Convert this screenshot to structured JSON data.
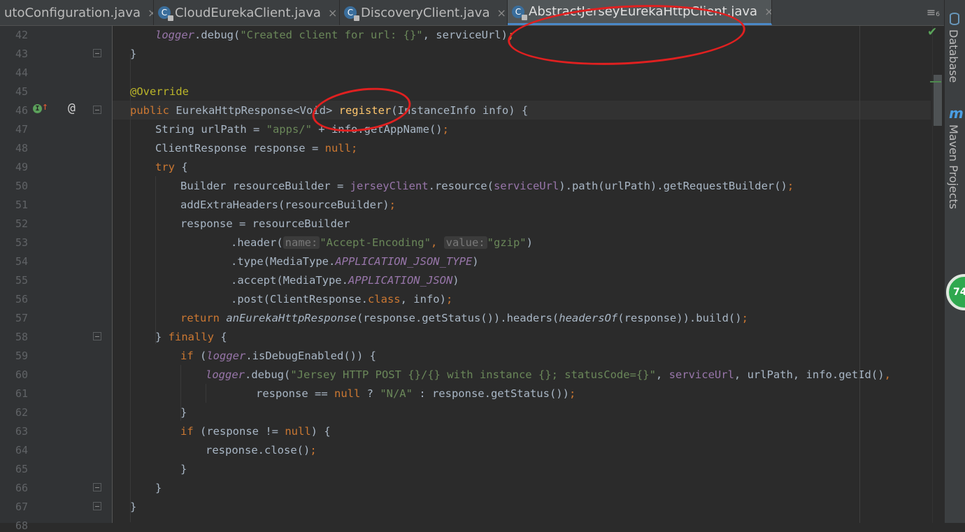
{
  "tabs": [
    {
      "label": "utoConfiguration.java",
      "close": "×",
      "icon": "",
      "active": false
    },
    {
      "label": "CloudEurekaClient.java",
      "close": "×",
      "icon": "C",
      "active": false
    },
    {
      "label": "DiscoveryClient.java",
      "close": "×",
      "icon": "C",
      "active": false
    },
    {
      "label": "AbstractJerseyEurekaHttpClient.java",
      "close": "×",
      "icon": "C",
      "active": true
    }
  ],
  "tab_menu": "≡",
  "tab_menu_count": "6",
  "tool_windows": {
    "database": "Database",
    "maven": "Maven Projects",
    "maven_icon": "m"
  },
  "status_badge": "74",
  "inspection_ok": "✔",
  "gutter": {
    "line_numbers": [
      "42",
      "43",
      "44",
      "45",
      "46",
      "47",
      "48",
      "49",
      "50",
      "51",
      "52",
      "53",
      "54",
      "55",
      "56",
      "57",
      "58",
      "59",
      "60",
      "61",
      "62",
      "63",
      "64",
      "65",
      "66",
      "67",
      "68"
    ],
    "implement_marker": "I",
    "override_arrow": "↑",
    "annotation_marker": "@"
  },
  "hints": {
    "name": "name:",
    "value": "value:"
  },
  "code": {
    "l42_a": "logger",
    "l42_b": ".debug(",
    "l42_c": "\"Created client for url: {}\"",
    "l42_d": ", serviceUrl)",
    "l42_e": ";",
    "l43": "}",
    "l45": "@Override",
    "l46_a": "public ",
    "l46_b": "EurekaHttpResponse<Void> ",
    "l46_c": "register",
    "l46_d": "(InstanceInfo info) {",
    "l47_a": "String urlPath = ",
    "l47_b": "\"apps/\"",
    "l47_c": " + info.getAppName()",
    "l47_d": ";",
    "l48_a": "ClientResponse response = ",
    "l48_b": "null",
    "l48_c": ";",
    "l49_a": "try",
    "l49_b": " {",
    "l50_a": "Builder resourceBuilder = ",
    "l50_b": "jerseyClient",
    "l50_c": ".resource(",
    "l50_d": "serviceUrl",
    "l50_e": ").path(urlPath).getRequestBuilder()",
    "l50_f": ";",
    "l51_a": "addExtraHeaders(resourceBuilder)",
    "l51_b": ";",
    "l52": "response = resourceBuilder",
    "l53_a": ".header(",
    "l53_b": "\"Accept-Encoding\"",
    "l53_c": ", ",
    "l53_d": "\"gzip\"",
    "l53_e": ")",
    "l54_a": ".type(MediaType.",
    "l54_b": "APPLICATION_JSON_TYPE",
    "l54_c": ")",
    "l55_a": ".accept(MediaType.",
    "l55_b": "APPLICATION_JSON",
    "l55_c": ")",
    "l56_a": ".post(ClientResponse.",
    "l56_b": "class",
    "l56_c": ", info)",
    "l56_d": ";",
    "l57_a": "return ",
    "l57_b": "anEurekaHttpResponse",
    "l57_c": "(response.getStatus()).headers(",
    "l57_d": "headersOf",
    "l57_e": "(response)).build()",
    "l57_f": ";",
    "l58_a": "} ",
    "l58_b": "finally",
    "l58_c": " {",
    "l59_a": "if ",
    "l59_b": "(",
    "l59_c": "logger",
    "l59_d": ".isDebugEnabled()) {",
    "l60_a": "logger",
    "l60_b": ".debug(",
    "l60_c": "\"Jersey HTTP POST {}/{} with instance {}; statusCode={}\"",
    "l60_d": ", ",
    "l60_e": "serviceUrl",
    "l60_f": ", urlPath, info.getId()",
    "l60_g": ",",
    "l61_a": "response == ",
    "l61_b": "null",
    "l61_c": " ? ",
    "l61_d": "\"N/A\"",
    "l61_e": " : response.getStatus())",
    "l61_f": ";",
    "l62": "}",
    "l63_a": "if ",
    "l63_b": "(response != ",
    "l63_c": "null",
    "l63_d": ") {",
    "l64_a": "response.close()",
    "l64_b": ";",
    "l65": "}",
    "l66": "}",
    "l67": "}"
  },
  "annotation_color": "#e02020"
}
